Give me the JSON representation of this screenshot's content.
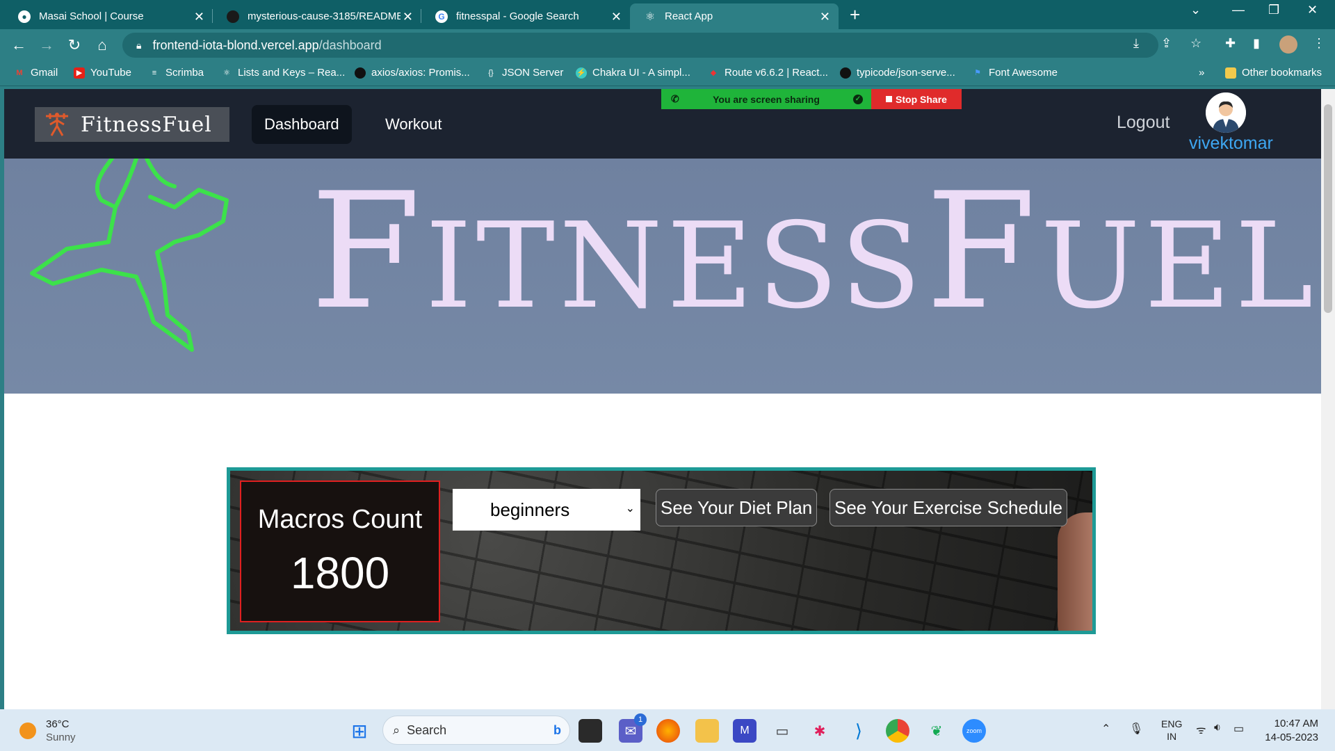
{
  "browser": {
    "tabs": [
      {
        "title": "Masai School | Course"
      },
      {
        "title": "mysterious-cause-3185/README"
      },
      {
        "title": "fitnesspal - Google Search"
      },
      {
        "title": "React App"
      }
    ],
    "url_domain": "frontend-iota-blond.vercel.app",
    "url_path": "/dashboard",
    "bookmarks": [
      {
        "label": "Gmail"
      },
      {
        "label": "YouTube"
      },
      {
        "label": "Scrimba"
      },
      {
        "label": "Lists and Keys – Rea..."
      },
      {
        "label": "axios/axios: Promis..."
      },
      {
        "label": "JSON Server"
      },
      {
        "label": "Chakra UI - A simpl..."
      },
      {
        "label": "Route v6.6.2 | React..."
      },
      {
        "label": "typicode/json-serve..."
      },
      {
        "label": "Font Awesome"
      }
    ],
    "other_bookmarks": "Other bookmarks",
    "bookmarks_overflow": "»"
  },
  "share_bar": {
    "status": "You are screen sharing",
    "stop": "Stop Share"
  },
  "app": {
    "logo_text": "FitnessFuel",
    "nav": [
      {
        "label": "Dashboard"
      },
      {
        "label": "Workout"
      }
    ],
    "logout": "Logout",
    "username": "vivektomar",
    "hero_brand": {
      "f1": "F",
      "r1": "ITNESS",
      "f2": "F",
      "r2": "UEL"
    },
    "macros_label": "Macros Count",
    "macros_value": "1800",
    "level_selected": "beginners",
    "diet_button": "See Your Diet Plan",
    "exercise_button": "See Your Exercise Schedule"
  },
  "taskbar": {
    "weather_temp": "36°C",
    "weather_desc": "Sunny",
    "search": "Search",
    "lang1": "ENG",
    "lang2": "IN",
    "time": "10:47 AM",
    "date": "14-05-2023",
    "teams_badge": "1"
  },
  "colors": {
    "accent_teal": "#2d7f85",
    "app_nav": "#1c2330",
    "username_blue": "#3ea7f2",
    "panel_border": "#1e9a96",
    "macros_border": "#e02020"
  }
}
